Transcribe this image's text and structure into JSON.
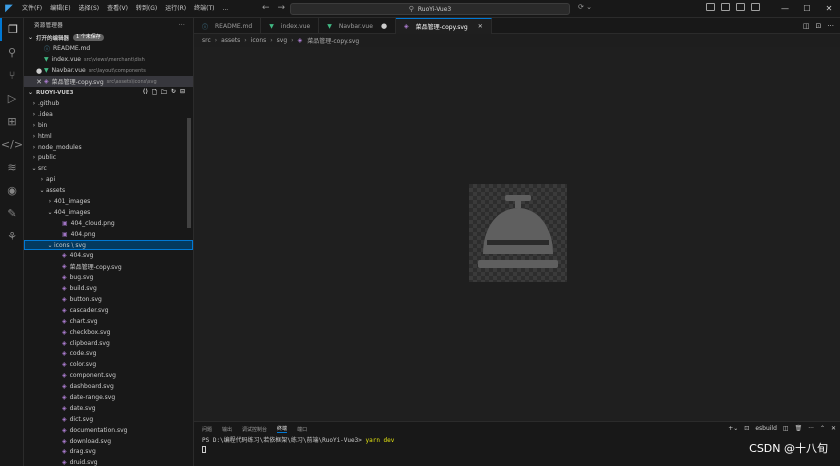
{
  "titlebar": {
    "menu": [
      "文件(F)",
      "编辑(E)",
      "选择(S)",
      "查看(V)",
      "转到(G)",
      "运行(R)",
      "终端(T)",
      "..."
    ],
    "search_text": "RuoYi-Vue3",
    "controls": [
      "—",
      "☐",
      "✕"
    ]
  },
  "sidebar": {
    "title": "资源管理器",
    "open_editors": {
      "label": "打开的编辑器",
      "badge": "1 个未保存",
      "items": [
        {
          "mark": "",
          "icon": "info",
          "name": "README.md",
          "path": "",
          "selected": false
        },
        {
          "mark": "",
          "icon": "vue",
          "name": "index.vue",
          "path": "src\\views\\merchant\\dish",
          "selected": false
        },
        {
          "mark": "●",
          "icon": "vue",
          "name": "Navbar.vue",
          "path": "src\\layout\\components",
          "selected": false
        },
        {
          "mark": "✕",
          "icon": "svg",
          "name": "菜品管理-copy.svg",
          "path": "src\\assets\\icons\\svg",
          "selected": true
        }
      ]
    },
    "project": {
      "label": "RUOYI-VUE3",
      "tree": [
        {
          "depth": 1,
          "chev": "›",
          "name": ".github",
          "icon": ""
        },
        {
          "depth": 1,
          "chev": "›",
          "name": ".idea",
          "icon": ""
        },
        {
          "depth": 1,
          "chev": "›",
          "name": "bin",
          "icon": ""
        },
        {
          "depth": 1,
          "chev": "›",
          "name": "html",
          "icon": ""
        },
        {
          "depth": 1,
          "chev": "›",
          "name": "node_modules",
          "icon": ""
        },
        {
          "depth": 1,
          "chev": "›",
          "name": "public",
          "icon": ""
        },
        {
          "depth": 1,
          "chev": "⌄",
          "name": "src",
          "icon": ""
        },
        {
          "depth": 2,
          "chev": "›",
          "name": "api",
          "icon": ""
        },
        {
          "depth": 2,
          "chev": "⌄",
          "name": "assets",
          "icon": ""
        },
        {
          "depth": 3,
          "chev": "›",
          "name": "401_images",
          "icon": ""
        },
        {
          "depth": 3,
          "chev": "⌄",
          "name": "404_images",
          "icon": ""
        },
        {
          "depth": 4,
          "chev": "",
          "name": "404_cloud.png",
          "icon": "img"
        },
        {
          "depth": 4,
          "chev": "",
          "name": "404.png",
          "icon": "img"
        },
        {
          "depth": 3,
          "chev": "⌄",
          "name": "icons \\ svg",
          "icon": "",
          "selected": true
        },
        {
          "depth": 4,
          "chev": "",
          "name": "404.svg",
          "icon": "svg"
        },
        {
          "depth": 4,
          "chev": "",
          "name": "菜品管理-copy.svg",
          "icon": "svg"
        },
        {
          "depth": 4,
          "chev": "",
          "name": "bug.svg",
          "icon": "svg"
        },
        {
          "depth": 4,
          "chev": "",
          "name": "build.svg",
          "icon": "svg"
        },
        {
          "depth": 4,
          "chev": "",
          "name": "button.svg",
          "icon": "svg"
        },
        {
          "depth": 4,
          "chev": "",
          "name": "cascader.svg",
          "icon": "svg"
        },
        {
          "depth": 4,
          "chev": "",
          "name": "chart.svg",
          "icon": "svg"
        },
        {
          "depth": 4,
          "chev": "",
          "name": "checkbox.svg",
          "icon": "svg"
        },
        {
          "depth": 4,
          "chev": "",
          "name": "clipboard.svg",
          "icon": "svg"
        },
        {
          "depth": 4,
          "chev": "",
          "name": "code.svg",
          "icon": "svg"
        },
        {
          "depth": 4,
          "chev": "",
          "name": "color.svg",
          "icon": "svg"
        },
        {
          "depth": 4,
          "chev": "",
          "name": "component.svg",
          "icon": "svg"
        },
        {
          "depth": 4,
          "chev": "",
          "name": "dashboard.svg",
          "icon": "svg"
        },
        {
          "depth": 4,
          "chev": "",
          "name": "date-range.svg",
          "icon": "svg"
        },
        {
          "depth": 4,
          "chev": "",
          "name": "date.svg",
          "icon": "svg"
        },
        {
          "depth": 4,
          "chev": "",
          "name": "dict.svg",
          "icon": "svg"
        },
        {
          "depth": 4,
          "chev": "",
          "name": "documentation.svg",
          "icon": "svg"
        },
        {
          "depth": 4,
          "chev": "",
          "name": "download.svg",
          "icon": "svg"
        },
        {
          "depth": 4,
          "chev": "",
          "name": "drag.svg",
          "icon": "svg"
        },
        {
          "depth": 4,
          "chev": "",
          "name": "druid.svg",
          "icon": "svg"
        }
      ]
    }
  },
  "tabs": [
    {
      "icon": "info",
      "label": "README.md",
      "active": false,
      "dirty": false
    },
    {
      "icon": "vue",
      "label": "index.vue",
      "active": false,
      "dirty": false
    },
    {
      "icon": "vue",
      "label": "Navbar.vue",
      "active": false,
      "dirty": true
    },
    {
      "icon": "svg",
      "label": "菜品管理-copy.svg",
      "active": true,
      "dirty": false
    }
  ],
  "breadcrumb": [
    "src",
    "assets",
    "icons",
    "svg",
    "菜品管理-copy.svg"
  ],
  "panel": {
    "tabs": [
      "问题",
      "输出",
      "调试控制台",
      "终端",
      "端口"
    ],
    "active_tab": "终端",
    "terminal_name": "esbuild",
    "prompt": "PS D:\\编程代码练习\\若依框架\\练习\\前端\\RuoYi-Vue3> ",
    "command": "yarn dev"
  },
  "watermark": "CSDN @十八旬",
  "colors": {
    "accent": "#0078d4",
    "vue": "#41b883",
    "svg": "#b180d7",
    "bell": "#5f5f5f"
  }
}
